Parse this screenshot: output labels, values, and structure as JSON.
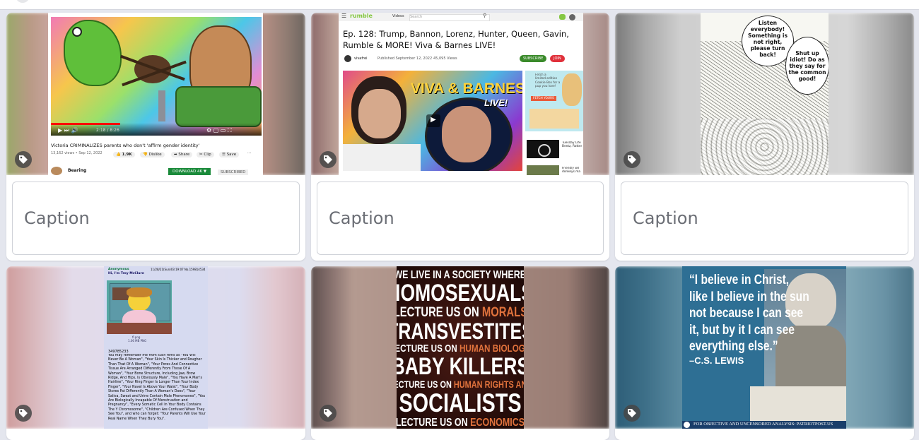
{
  "gallery": {
    "caption_placeholder": "Caption",
    "items": [
      {
        "kind": "youtube-screenshot",
        "player_time": "2:18 / 8:26",
        "video_title": "Victoria CRIMINALIZES parents who don't 'affirm gender identity'",
        "views_date": "13,162 views • Sep 12, 2022",
        "likes": "1.9K",
        "dislike": "Dislike",
        "share": "Share",
        "clip": "Clip",
        "save": "Save",
        "channel": "Bearing",
        "download": "DOWNLOAD 4K ▼",
        "subscribed": "SUBSCRIBED"
      },
      {
        "kind": "rumble-screenshot",
        "logo": "rumble",
        "videos_dropdown": "Videos",
        "search_placeholder": "Search",
        "title": "Ep. 128: Trump, Bannon, Lorenz, Hunter, Queen, Gavin, Rumble & MORE! Viva & Barnes LIVE!",
        "channel": "vivafrei",
        "published": "Published September 12, 2022",
        "views": "45,095 Views",
        "subscribe": "SUBSCRIBE",
        "join": "JOIN",
        "thumb_line1": "VIVA & BARNES",
        "thumb_line2": "LIVE!",
        "ad_line1": "Fetch a",
        "ad_line2": "limited-edition",
        "ad_line3": "Cookie Box for a",
        "ad_line4": "pup you love!",
        "ad_button": "FETCH YOURS",
        "side1_title": "Tuesday Life Bentz, Ratter",
        "side2_title": "Friendly wil donkeys ma"
      },
      {
        "kind": "cartoon",
        "bubble1": "Listen everybody! Something is not right, please turn back!",
        "bubble2": "Shut up idiot! Do as they say for the common good!"
      },
      {
        "kind": "imageboard-post",
        "poster": "Anonymous",
        "subject": "Hi, I'm Troy McClure",
        "meta": "11/28/21(Sun)03:19:07 No.159814534",
        "file_name": "fl.png",
        "file_size": "1.06 MB PNG",
        "reply": "349785233",
        "body": "You may remember me from such films as \"You Will Never Be A Woman\", \"Your Skin Is Thicker and Rougher Than That Of A Woman\", \"Your Pores And Connective Tissue Are Arranged Differently From Those Of A Woman\", \"Your Bone Structure, Including Jaw, Brow Ridge, And Hips, Is Obviously Male\", \"You Have A Man's Hairline\", \"Your Ring Finger Is Longer Than Your Index Finger\", \"Your Navel Is Above Your Waist\", \"Your Body Stores Fat Differently Than A Woman's Does\", \"Your Saliva, Sweat and Urine Contain Male Pheromones\", \"You Are Biologically Incapable Of Menstruation and Pregnancy\", \"Every Somatic Cell In Your Body Contains The Y Chromosome\", \"Children Are Confused When They See You\", and who can forget: \"Your Parents Will Use Your Real Name When They Bury You\"."
      },
      {
        "kind": "poster",
        "lines": [
          {
            "text": "WE LIVE IN A SOCIETY WHERE",
            "color": "#ffffff",
            "size": 16
          },
          {
            "text": "HOMOSEXUALS",
            "color": "#ffffff",
            "size": 34
          },
          {
            "text": "LECTURE US ON ",
            "accent": "MORALS",
            "color": "#ffffff",
            "size": 19
          },
          {
            "text": "TRANSVESTITES",
            "color": "#ffffff",
            "size": 32
          },
          {
            "text": "LECTURE US ON ",
            "accent": "HUMAN BIOLOGY",
            "color": "#ffffff",
            "size": 15
          },
          {
            "text": "BABY KILLERS",
            "color": "#ffffff",
            "size": 34
          },
          {
            "text": "LECTURE US ON ",
            "accent": "HUMAN RIGHTS AND",
            "color": "#ffffff",
            "size": 14
          },
          {
            "text": "SOCIALISTS",
            "color": "#ffffff",
            "size": 37
          },
          {
            "text": "LECTURE US ON ",
            "accent": "ECONOMICS",
            "color": "#ffffff",
            "size": 16
          }
        ],
        "accent_color": "#e0723c"
      },
      {
        "kind": "quote-poster",
        "quote_lines": [
          "“I believe in Christ,",
          "like I believe in the sun",
          "not because I can see",
          "it, but by it I can see",
          "everything else.”"
        ],
        "attribution": "–C.S. LEWIS",
        "footer": "FOR OBJECTIVE AND UNCENSORED ANALYSIS: PATRIOTPOST.US"
      }
    ]
  }
}
